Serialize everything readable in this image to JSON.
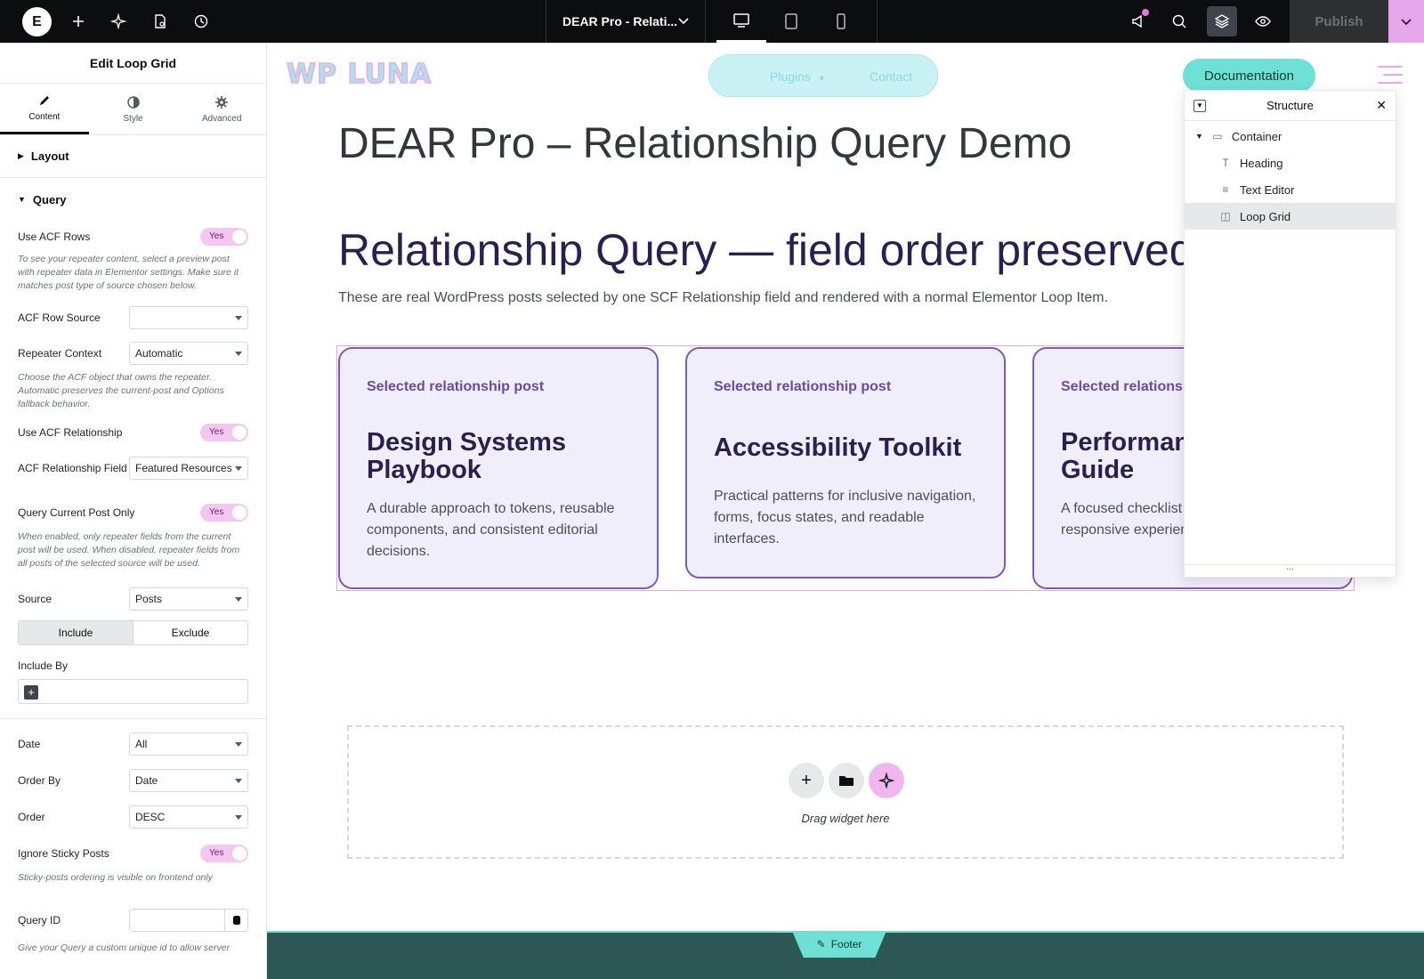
{
  "topbar": {
    "document_title": "DEAR Pro - Relati...",
    "publish_label": "Publish",
    "logo_glyph": "E"
  },
  "panel": {
    "title": "Edit Loop Grid",
    "tabs": [
      {
        "label": "Content",
        "icon": "pencil-icon"
      },
      {
        "label": "Style",
        "icon": "half-circle-icon"
      },
      {
        "label": "Advanced",
        "icon": "gear-icon"
      }
    ],
    "sections": {
      "layout": "Layout",
      "query": "Query"
    },
    "use_acf_rows": {
      "label": "Use ACF Rows",
      "value": "Yes"
    },
    "acf_rows_help": "To see your repeater content, select a preview post with repeater data in Elementor settings. Make sure it matches post type of source chosen below.",
    "acf_row_source": {
      "label": "ACF Row Source",
      "value": ""
    },
    "repeater_context": {
      "label": "Repeater Context",
      "value": "Automatic"
    },
    "repeater_help": "Choose the ACF object that owns the repeater. Automatic preserves the current-post and Options fallback behavior.",
    "use_acf_relationship": {
      "label": "Use ACF Relationship",
      "value": "Yes"
    },
    "acf_relationship_field": {
      "label": "ACF Relationship Field",
      "value": "Featured Resources"
    },
    "query_current_post_only": {
      "label": "Query Current Post Only",
      "value": "Yes"
    },
    "current_post_help": "When enabled, only repeater fields from the current post will be used. When disabled, repeater fields from all posts of the selected source will be used.",
    "source": {
      "label": "Source",
      "value": "Posts"
    },
    "include_exclude": {
      "include": "Include",
      "exclude": "Exclude"
    },
    "include_by": {
      "label": "Include By"
    },
    "date": {
      "label": "Date",
      "value": "All"
    },
    "order_by": {
      "label": "Order By",
      "value": "Date"
    },
    "order": {
      "label": "Order",
      "value": "DESC"
    },
    "ignore_sticky": {
      "label": "Ignore Sticky Posts",
      "value": "Yes"
    },
    "sticky_help": "Sticky-posts ordering is visible on frontend only",
    "query_id": {
      "label": "Query ID",
      "value": ""
    },
    "query_id_help": "Give your Query a custom unique id to allow server"
  },
  "canvas": {
    "site_logo": "WP LUNA",
    "nav": {
      "plugins": "Plugins",
      "contact": "Contact"
    },
    "documentation_button": "Documentation",
    "page_title": "DEAR Pro – Relationship Query Demo",
    "section_heading": "Relationship Query — field order preserved",
    "lead_text": "These are real WordPress posts selected by one SCF Relationship field and rendered with a normal Elementor Loop Item.",
    "cards": [
      {
        "kicker": "Selected relationship post",
        "title": "Design Systems Playbook",
        "body": "A durable approach to tokens, reusable components, and consistent editorial decisions."
      },
      {
        "kicker": "Selected relationship post",
        "title": "Accessibility Toolkit",
        "body": "Practical patterns for inclusive navigation, forms, focus states, and readable interfaces."
      },
      {
        "kicker": "Selected relationship post",
        "title": "Performance Guide",
        "body": "A focused checklist for lean assets, and responsive experiences."
      }
    ],
    "dropzone_text": "Drag widget here",
    "footer_tag": "Footer"
  },
  "structure": {
    "title": "Structure",
    "items": [
      {
        "label": "Container",
        "icon": "container-icon"
      },
      {
        "label": "Heading",
        "icon": "heading-icon"
      },
      {
        "label": "Text Editor",
        "icon": "text-editor-icon"
      },
      {
        "label": "Loop Grid",
        "icon": "loop-grid-icon"
      }
    ],
    "footer": "..."
  }
}
